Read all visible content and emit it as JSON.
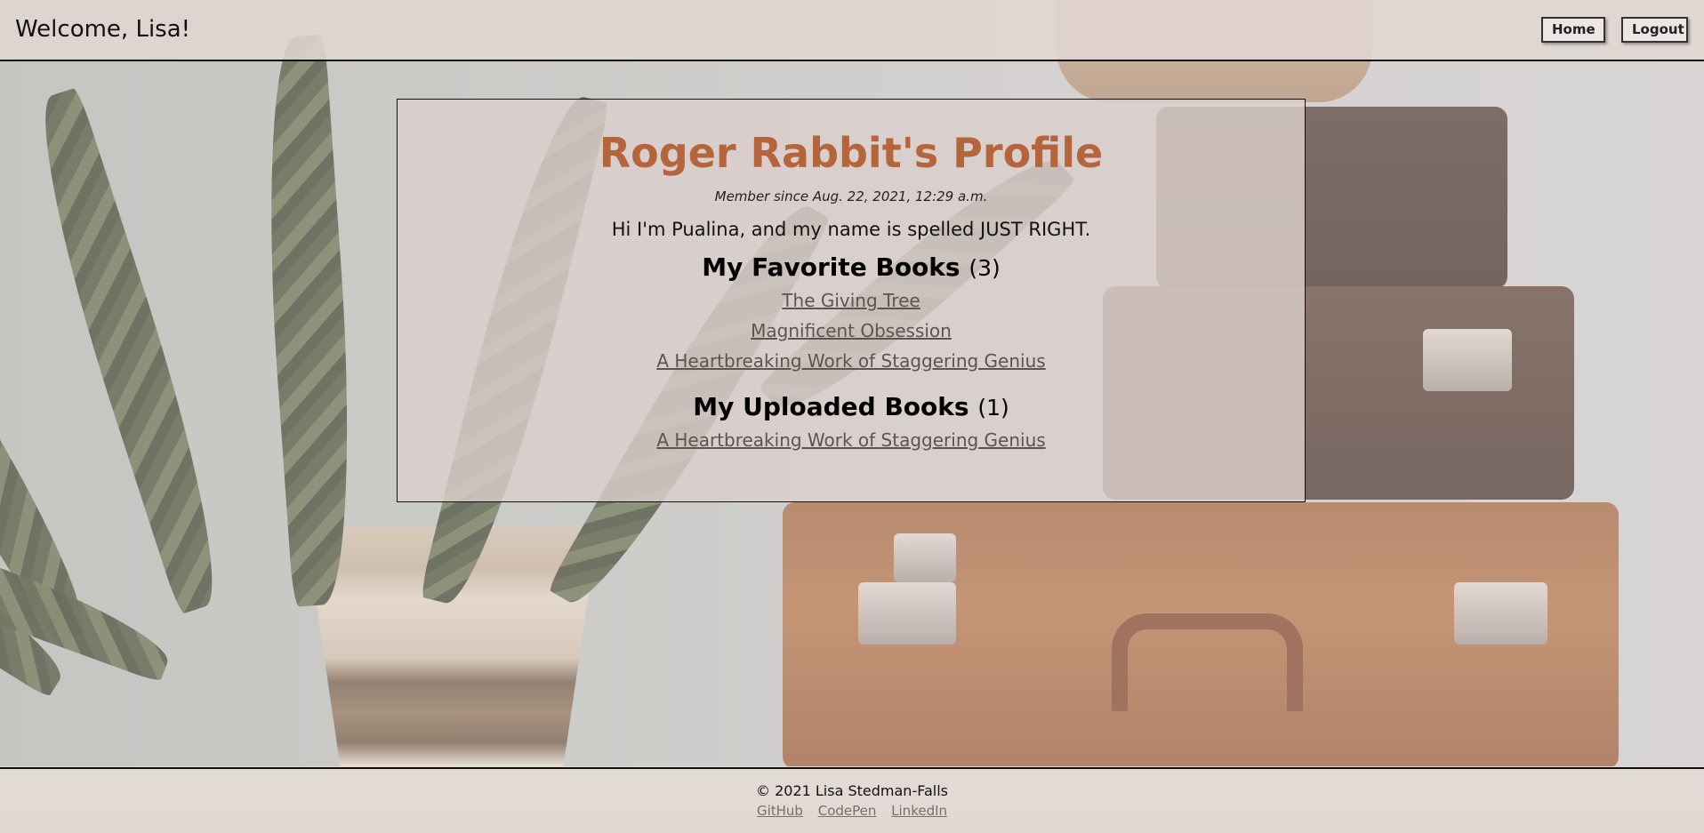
{
  "header": {
    "welcome": "Welcome, Lisa!",
    "home_label": "Home",
    "logout_label": "Logout"
  },
  "profile": {
    "title": "Roger Rabbit's Profile",
    "member_since": "Member since Aug. 22, 2021, 12:29 a.m.",
    "bio": "Hi I'm Pualina, and my name is spelled JUST RIGHT.",
    "favorites": {
      "heading": "My Favorite Books",
      "count": "(3)",
      "books": [
        "The Giving Tree",
        "Magnificent Obsession",
        "A Heartbreaking Work of Staggering Genius"
      ]
    },
    "uploads": {
      "heading": "My Uploaded Books",
      "count": "(1)",
      "books": [
        "A Heartbreaking Work of Staggering Genius"
      ]
    }
  },
  "footer": {
    "copyright": "© 2021 Lisa Stedman-Falls",
    "links": [
      "GitHub",
      "CodePen",
      "LinkedIn"
    ]
  },
  "colors": {
    "title_accent": "#b5653b",
    "link": "#5e5350"
  }
}
